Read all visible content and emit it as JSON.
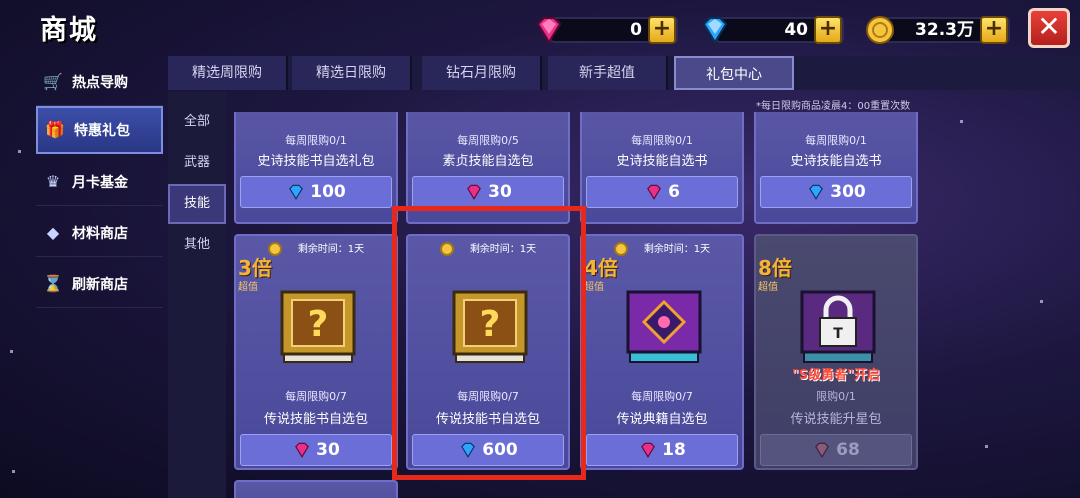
{
  "header": {
    "title": "商城"
  },
  "currencies": [
    {
      "icon": "pink-gem-icon",
      "value": "0"
    },
    {
      "icon": "blue-diamond-icon",
      "value": "40"
    },
    {
      "icon": "gold-coin-icon",
      "value": "32.3万"
    }
  ],
  "close_label": "✕",
  "sidebar": {
    "items": [
      {
        "label": "热点导购",
        "icon": "cart-icon"
      },
      {
        "label": "特惠礼包",
        "icon": "gift-icon",
        "active": true
      },
      {
        "label": "月卡基金",
        "icon": "crown-icon"
      },
      {
        "label": "材料商店",
        "icon": "gem-icon"
      },
      {
        "label": "刷新商店",
        "icon": "hourglass-icon"
      }
    ]
  },
  "tabs": [
    {
      "label": "精选周限购"
    },
    {
      "label": "精选日限购"
    },
    {
      "label": "钻石月限购"
    },
    {
      "label": "新手超值"
    },
    {
      "label": "礼包中心",
      "active": true
    }
  ],
  "subcats": [
    {
      "label": "全部"
    },
    {
      "label": "武器"
    },
    {
      "label": "技能",
      "active": true
    },
    {
      "label": "其他"
    }
  ],
  "notice": "*每日限购商品凌晨4：00重置次数",
  "top_cards": [
    {
      "limit": "每周限购0/1",
      "name": "史诗技能书自选礼包",
      "price": "100",
      "currency": "blue-diamond-icon"
    },
    {
      "limit": "每周限购0/5",
      "name": "素贞技能自选包",
      "price": "30",
      "currency": "pink-gem-icon"
    },
    {
      "limit": "每周限购0/1",
      "name": "史诗技能自选书",
      "price": "6",
      "currency": "pink-gem-icon"
    },
    {
      "limit": "每周限购0/1",
      "name": "史诗技能自选书",
      "price": "300",
      "currency": "blue-diamond-icon"
    }
  ],
  "bottom_cards": [
    {
      "timer": "剩余时间：1天",
      "mult": "3倍",
      "mult_sub": "超值",
      "limit": "每周限购0/7",
      "name": "传说技能书自选包",
      "price": "30",
      "currency": "pink-gem-icon"
    },
    {
      "timer": "剩余时间：1天",
      "mult": "",
      "mult_sub": "",
      "limit": "每周限购0/7",
      "name": "传说技能书自选包",
      "price": "600",
      "currency": "blue-diamond-icon"
    },
    {
      "timer": "剩余时间：1天",
      "mult": "4倍",
      "mult_sub": "超值",
      "limit": "每周限购0/7",
      "name": "传说典籍自选包",
      "price": "18",
      "currency": "pink-gem-icon"
    },
    {
      "timer": "",
      "mult": "8倍",
      "mult_sub": "超值",
      "limit": "限购0/1",
      "name": "传说技能升星包",
      "price": "68",
      "currency": "pink-gem-icon",
      "locked": true,
      "requirement": "\"S级勇者\"开启"
    }
  ],
  "colors": {
    "accent_red": "#e8291a",
    "gold": "#f4b43a",
    "panel": "#4a489a"
  }
}
